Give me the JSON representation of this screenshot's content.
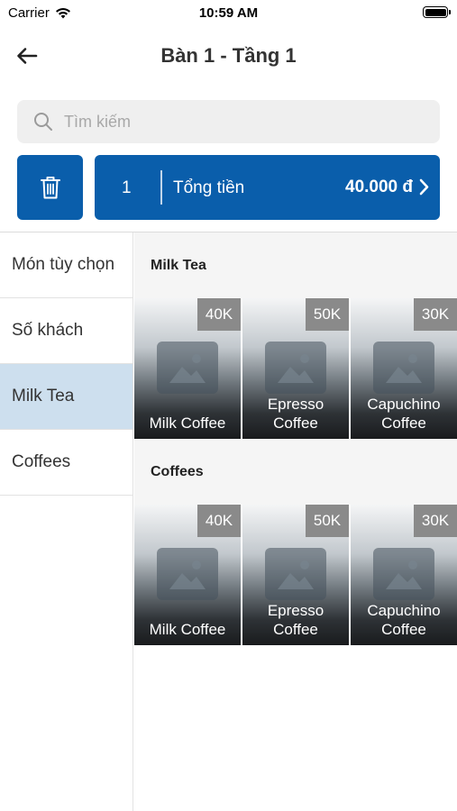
{
  "status_bar": {
    "carrier": "Carrier",
    "time": "10:59 AM"
  },
  "header": {
    "title": "Bàn 1 - Tầng 1"
  },
  "search": {
    "placeholder": "Tìm kiếm",
    "value": ""
  },
  "order_summary": {
    "count": "1",
    "total_label": "Tổng tiền",
    "total_amount": "40.000 đ"
  },
  "sidebar": {
    "items": [
      {
        "label": "Món tùy chọn",
        "active": false
      },
      {
        "label": "Số khách",
        "active": false
      },
      {
        "label": "Milk Tea",
        "active": true
      },
      {
        "label": "Coffees",
        "active": false
      }
    ]
  },
  "sections": [
    {
      "title": "Milk Tea",
      "products": [
        {
          "name": "Milk Coffee",
          "price": "40K"
        },
        {
          "name": "Epresso Coffee",
          "price": "50K"
        },
        {
          "name": "Capuchino Coffee",
          "price": "30K"
        }
      ]
    },
    {
      "title": "Coffees",
      "products": [
        {
          "name": "Milk Coffee",
          "price": "40K"
        },
        {
          "name": "Epresso Coffee",
          "price": "50K"
        },
        {
          "name": "Capuchino Coffee",
          "price": "30K"
        }
      ]
    }
  ],
  "colors": {
    "primary": "#0a5eab",
    "active_sidebar": "#cddfee",
    "price_badge": "#8a8a8a"
  },
  "icons": [
    "wifi-icon",
    "battery-icon",
    "back-arrow-icon",
    "search-icon",
    "trash-icon",
    "chevron-right-icon",
    "image-placeholder-icon"
  ]
}
